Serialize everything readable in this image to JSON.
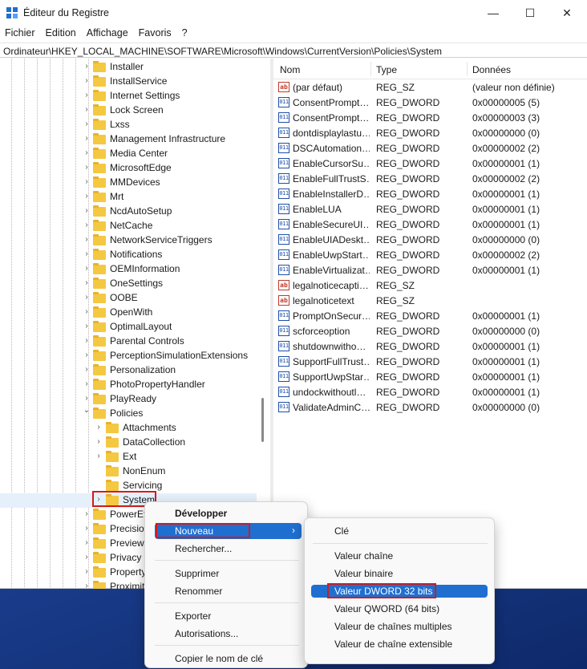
{
  "window": {
    "title": "Éditeur du Registre"
  },
  "menu": [
    "Fichier",
    "Edition",
    "Affichage",
    "Favoris",
    "?"
  ],
  "address": "Ordinateur\\HKEY_LOCAL_MACHINE\\SOFTWARE\\Microsoft\\Windows\\CurrentVersion\\Policies\\System",
  "tree": {
    "items": [
      "Installer",
      "InstallService",
      "Internet Settings",
      "Lock Screen",
      "Lxss",
      "Management Infrastructure",
      "Media Center",
      "MicrosoftEdge",
      "MMDevices",
      "Mrt",
      "NcdAutoSetup",
      "NetCache",
      "NetworkServiceTriggers",
      "Notifications",
      "OEMInformation",
      "OneSettings",
      "OOBE",
      "OpenWith",
      "OptimalLayout",
      "Parental Controls",
      "PerceptionSimulationExtensions",
      "Personalization",
      "PhotoPropertyHandler",
      "PlayReady",
      "Policies"
    ],
    "policies_children": [
      "Attachments",
      "DataCollection",
      "Ext",
      "NonEnum",
      "Servicing",
      "System"
    ],
    "after_items": [
      "PowerEf",
      "Precisio",
      "Preview",
      "Privacy",
      "Property",
      "Proximit"
    ]
  },
  "list": {
    "headers": {
      "name": "Nom",
      "type": "Type",
      "data": "Données"
    },
    "rows": [
      {
        "icon": "string-value-icon",
        "name": "(par défaut)",
        "type": "REG_SZ",
        "data": "(valeur non définie)"
      },
      {
        "icon": "dword-value-icon",
        "name": "ConsentPrompt…",
        "type": "REG_DWORD",
        "data": "0x00000005 (5)"
      },
      {
        "icon": "dword-value-icon",
        "name": "ConsentPrompt…",
        "type": "REG_DWORD",
        "data": "0x00000003 (3)"
      },
      {
        "icon": "dword-value-icon",
        "name": "dontdisplaylastu…",
        "type": "REG_DWORD",
        "data": "0x00000000 (0)"
      },
      {
        "icon": "dword-value-icon",
        "name": "DSCAutomation…",
        "type": "REG_DWORD",
        "data": "0x00000002 (2)"
      },
      {
        "icon": "dword-value-icon",
        "name": "EnableCursorSu…",
        "type": "REG_DWORD",
        "data": "0x00000001 (1)"
      },
      {
        "icon": "dword-value-icon",
        "name": "EnableFullTrustS…",
        "type": "REG_DWORD",
        "data": "0x00000002 (2)"
      },
      {
        "icon": "dword-value-icon",
        "name": "EnableInstallerD…",
        "type": "REG_DWORD",
        "data": "0x00000001 (1)"
      },
      {
        "icon": "dword-value-icon",
        "name": "EnableLUA",
        "type": "REG_DWORD",
        "data": "0x00000001 (1)"
      },
      {
        "icon": "dword-value-icon",
        "name": "EnableSecureUI…",
        "type": "REG_DWORD",
        "data": "0x00000001 (1)"
      },
      {
        "icon": "dword-value-icon",
        "name": "EnableUIADeskt…",
        "type": "REG_DWORD",
        "data": "0x00000000 (0)"
      },
      {
        "icon": "dword-value-icon",
        "name": "EnableUwpStart…",
        "type": "REG_DWORD",
        "data": "0x00000002 (2)"
      },
      {
        "icon": "dword-value-icon",
        "name": "EnableVirtualizat…",
        "type": "REG_DWORD",
        "data": "0x00000001 (1)"
      },
      {
        "icon": "string-value-icon",
        "name": "legalnoticecapti…",
        "type": "REG_SZ",
        "data": ""
      },
      {
        "icon": "string-value-icon",
        "name": "legalnoticetext",
        "type": "REG_SZ",
        "data": ""
      },
      {
        "icon": "dword-value-icon",
        "name": "PromptOnSecur…",
        "type": "REG_DWORD",
        "data": "0x00000001 (1)"
      },
      {
        "icon": "dword-value-icon",
        "name": "scforceoption",
        "type": "REG_DWORD",
        "data": "0x00000000 (0)"
      },
      {
        "icon": "dword-value-icon",
        "name": "shutdownwitho…",
        "type": "REG_DWORD",
        "data": "0x00000001 (1)"
      },
      {
        "icon": "dword-value-icon",
        "name": "SupportFullTrust…",
        "type": "REG_DWORD",
        "data": "0x00000001 (1)"
      },
      {
        "icon": "dword-value-icon",
        "name": "SupportUwpStar…",
        "type": "REG_DWORD",
        "data": "0x00000001 (1)"
      },
      {
        "icon": "dword-value-icon",
        "name": "undockwithoutl…",
        "type": "REG_DWORD",
        "data": "0x00000001 (1)"
      },
      {
        "icon": "dword-value-icon",
        "name": "ValidateAdminC…",
        "type": "REG_DWORD",
        "data": "0x00000000 (0)"
      }
    ]
  },
  "context_menu": {
    "items": [
      "Développer",
      "Nouveau",
      "Rechercher...",
      "Supprimer",
      "Renommer",
      "Exporter",
      "Autorisations...",
      "Copier le nom de clé"
    ],
    "submenu": [
      "Clé",
      "Valeur chaîne",
      "Valeur binaire",
      "Valeur DWORD 32 bits",
      "Valeur QWORD (64 bits)",
      "Valeur de chaînes multiples",
      "Valeur de chaîne extensible"
    ]
  },
  "colors": {
    "highlight": "#1f6fd1",
    "callout": "#d11b1b",
    "folder": "#f5c842"
  },
  "icons": {
    "expand": "›",
    "expanded": "⌄",
    "submenu": "›"
  }
}
